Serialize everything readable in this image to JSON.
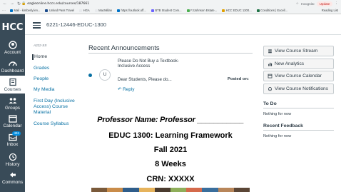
{
  "browser": {
    "url": "eagleonline.hccs.edu/courses/187661",
    "incognito_label": "Incognito",
    "update_label": "Update",
    "bookmarks": [
      {
        "label": "Mail - kimberly.len...",
        "icon": "outlook-icon",
        "color": "#0072c6"
      },
      {
        "label": "United Pass Travel",
        "icon": "airline-icon",
        "color": "#1a4b8c"
      },
      {
        "label": "HGA",
        "icon": "folder-icon",
        "color": "#e8eaed"
      },
      {
        "label": "MacMillan",
        "icon": "folder-icon",
        "color": "#e8eaed"
      },
      {
        "label": "https://outlook.off...",
        "icon": "outlook-icon",
        "color": "#0072c6"
      },
      {
        "label": "BTB Student Com...",
        "icon": "doc-icon",
        "color": "#6c63ff"
      },
      {
        "label": "FJJohnson Estate...",
        "icon": "doc-icon",
        "color": "#4caf50"
      },
      {
        "label": "HCC EDUC 1300...",
        "icon": "doc-icon",
        "color": "#e0a000"
      },
      {
        "label": "Conditions | Excell...",
        "icon": "doc-icon",
        "color": "#217346"
      }
    ],
    "reading_list": "Reading List"
  },
  "global_nav": {
    "logo": "HCC",
    "items": [
      {
        "label": "Account",
        "icon": "account-icon"
      },
      {
        "label": "Dashboard",
        "icon": "dashboard-icon"
      },
      {
        "label": "Courses",
        "icon": "courses-icon",
        "active": true
      },
      {
        "label": "Groups",
        "icon": "groups-icon"
      },
      {
        "label": "Calendar",
        "icon": "calendar-icon"
      },
      {
        "label": "Inbox",
        "icon": "inbox-icon",
        "badge": "491"
      },
      {
        "label": "History",
        "icon": "history-icon"
      },
      {
        "label": "Commons",
        "icon": "commons-icon"
      }
    ]
  },
  "course": {
    "breadcrumb": "6221-12446-EDUC-1300",
    "term": "A222-SS"
  },
  "course_nav": [
    {
      "label": "Home",
      "active": true
    },
    {
      "label": "Grades"
    },
    {
      "label": "People"
    },
    {
      "label": "My Media"
    },
    {
      "label": "First Day (Inclusive Access) Course Material"
    },
    {
      "label": "Course Syllabus"
    }
  ],
  "announcements": {
    "title": "Recent Announcements",
    "items": [
      {
        "avatar": "U",
        "heading": "Please Do Not Buy a Textbook- Inclusive Access",
        "preview": "Dear Students, Please do...",
        "posted_label": "Posted on:",
        "reply_label": "Reply"
      }
    ]
  },
  "syllabus": {
    "professor_line": "Professor Name:  Professor ___________",
    "course_line": "EDUC 1300: Learning Framework",
    "semester": "Fall 2021",
    "duration": "8 Weeks",
    "crn": "CRN: XXXXX"
  },
  "sidebar": {
    "buttons": [
      {
        "label": "View Course Stream",
        "icon": "stream-icon"
      },
      {
        "label": "New Analytics",
        "icon": "analytics-icon"
      },
      {
        "label": "View Course Calendar",
        "icon": "calendar-icon"
      },
      {
        "label": "View Course Notifications",
        "icon": "bell-icon"
      }
    ],
    "todo_title": "To Do",
    "todo_empty": "Nothing for now",
    "feedback_title": "Recent Feedback",
    "feedback_empty": "Nothing for now"
  },
  "colors": {
    "nav_bg": "#394b58",
    "link": "#0770a3",
    "text": "#2d3b45"
  }
}
